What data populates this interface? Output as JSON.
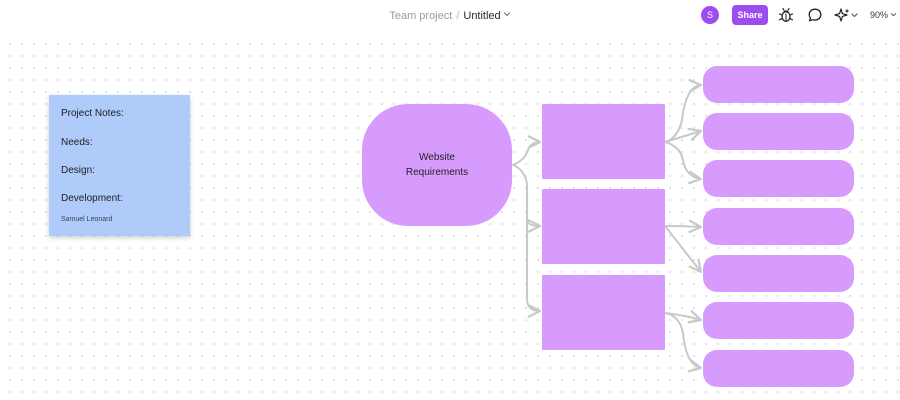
{
  "header": {
    "project": "Team project",
    "separator": "/",
    "file_name": "Untitled",
    "avatar_initial": "S",
    "share_label": "Share",
    "zoom": "90%",
    "icons": [
      "chevron-down-icon",
      "bug-icon",
      "comment-icon",
      "sparkle-icon",
      "chevron-down-icon"
    ]
  },
  "sticky_note": {
    "color": "#aecbfa",
    "lines": [
      "Project Notes:",
      "Needs:",
      "Design:",
      "Development:"
    ],
    "author": "Samuel Leonard"
  },
  "diagram": {
    "node_color": "#d79bfd",
    "connector_color": "#c9c9c9",
    "central_node": {
      "line1": "Website",
      "line2": "Requirements"
    },
    "branch_count": 3,
    "leaf_count": 7
  },
  "colors": {
    "accent": "#9d4cf0",
    "canvas_dots": "#dadadf"
  }
}
